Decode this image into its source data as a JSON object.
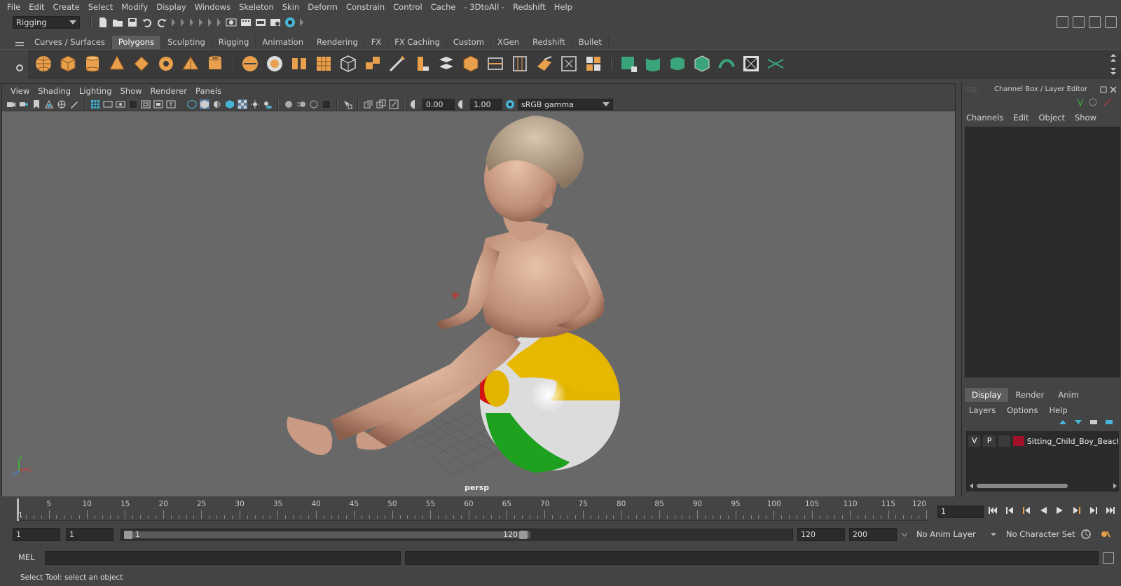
{
  "menubar": [
    "File",
    "Edit",
    "Create",
    "Select",
    "Modify",
    "Display",
    "Windows",
    "Skeleton",
    "Skin",
    "Deform",
    "Constrain",
    "Control",
    "Cache",
    "- 3DtoAll -",
    "Redshift",
    "Help"
  ],
  "status": {
    "mode": "Rigging"
  },
  "shelf": {
    "tabs": [
      "Curves / Surfaces",
      "Polygons",
      "Sculpting",
      "Rigging",
      "Animation",
      "Rendering",
      "FX",
      "FX Caching",
      "Custom",
      "XGen",
      "Redshift",
      "Bullet"
    ],
    "active": "Polygons"
  },
  "viewport": {
    "menu": [
      "View",
      "Shading",
      "Lighting",
      "Show",
      "Renderer",
      "Panels"
    ],
    "exposure": "0.00",
    "gamma": "1.00",
    "colorspace": "sRGB gamma",
    "camera": "persp"
  },
  "channelbox": {
    "title": "Channel Box / Layer Editor",
    "menu": [
      "Channels",
      "Edit",
      "Object",
      "Show"
    ]
  },
  "layers": {
    "tabs": [
      "Display",
      "Render",
      "Anim"
    ],
    "active": "Display",
    "menu": [
      "Layers",
      "Options",
      "Help"
    ],
    "row": {
      "v": "V",
      "p": "P",
      "name": "Sitting_Child_Boy_Beach",
      "color": "#a1122a"
    }
  },
  "timeslider": {
    "ticks": [
      "5",
      "10",
      "15",
      "20",
      "25",
      "30",
      "35",
      "40",
      "45",
      "50",
      "55",
      "60",
      "65",
      "70",
      "75",
      "80",
      "85",
      "90",
      "95",
      "100",
      "105",
      "110",
      "115",
      "120"
    ],
    "start_label": "1",
    "current_frame": "1"
  },
  "range": {
    "start": "1",
    "playback_start": "1",
    "slider_min": "1",
    "slider_max": "120",
    "playback_end": "120",
    "end": "200",
    "anim_layer": "No Anim Layer",
    "character_set": "No Character Set"
  },
  "cmdline": {
    "lang": "MEL"
  },
  "helpline": "Select Tool: select an object",
  "colors": {
    "accent": "#5d5d5d",
    "shelf_icon": "#e8a04c",
    "shelf_icon_green": "#3aa57a",
    "layer": "#a1122a"
  }
}
